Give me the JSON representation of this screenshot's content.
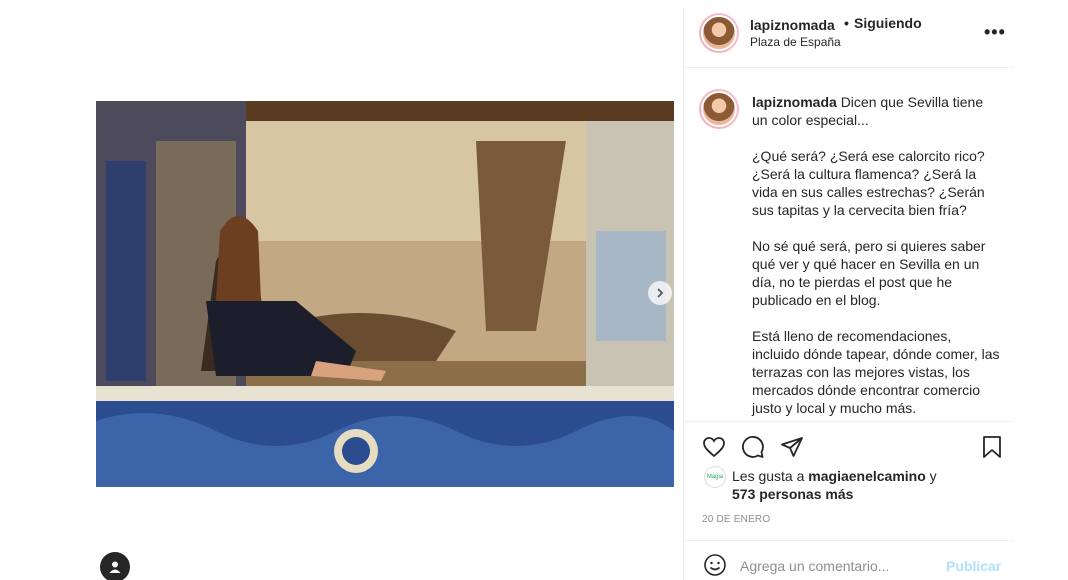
{
  "post": {
    "username": "lapiznomada",
    "dot": "•",
    "follow_status": "Siguiendo",
    "location": "Plaza de España",
    "more_label": "•••"
  },
  "caption": {
    "username": "lapiznomada",
    "intro": "Dicen que Sevilla tiene un color especial...",
    "p1": "¿Qué será? ¿Será ese calorcito rico? ¿Será la cultura flamenca? ¿Será la vida en sus calles estrechas? ¿Serán sus tapitas y la cervecita bien fría?",
    "p2": "No sé qué será, pero si quieres saber qué ver y qué hacer en Sevilla en un día, no te pierdas el post que he publicado en el blog.",
    "p3": "Está lleno de recomendaciones, incluido dónde tapear, dónde comer, las terrazas con las mejores vistas, los mercados dónde encontrar comercio justo y local y mucho más."
  },
  "likes": {
    "prefix": "Les gusta a",
    "user": "magiaenelcamino",
    "connector": "y",
    "others": "573 personas más",
    "mini_avatar_text": "Magia"
  },
  "date": "20 DE ENERO",
  "comment": {
    "placeholder": "Agrega un comentario...",
    "publish_label": "Publicar"
  },
  "icons": {
    "like": "heart-icon",
    "comment": "comment-icon",
    "share": "paper-plane-icon",
    "save": "bookmark-icon",
    "emoji": "smiley-icon",
    "next": "chevron-right-icon",
    "user": "user-icon"
  },
  "colors": {
    "publish_disabled": "#b2dffc",
    "secondary_text": "#8e8e8e",
    "divider": "#efefef"
  }
}
